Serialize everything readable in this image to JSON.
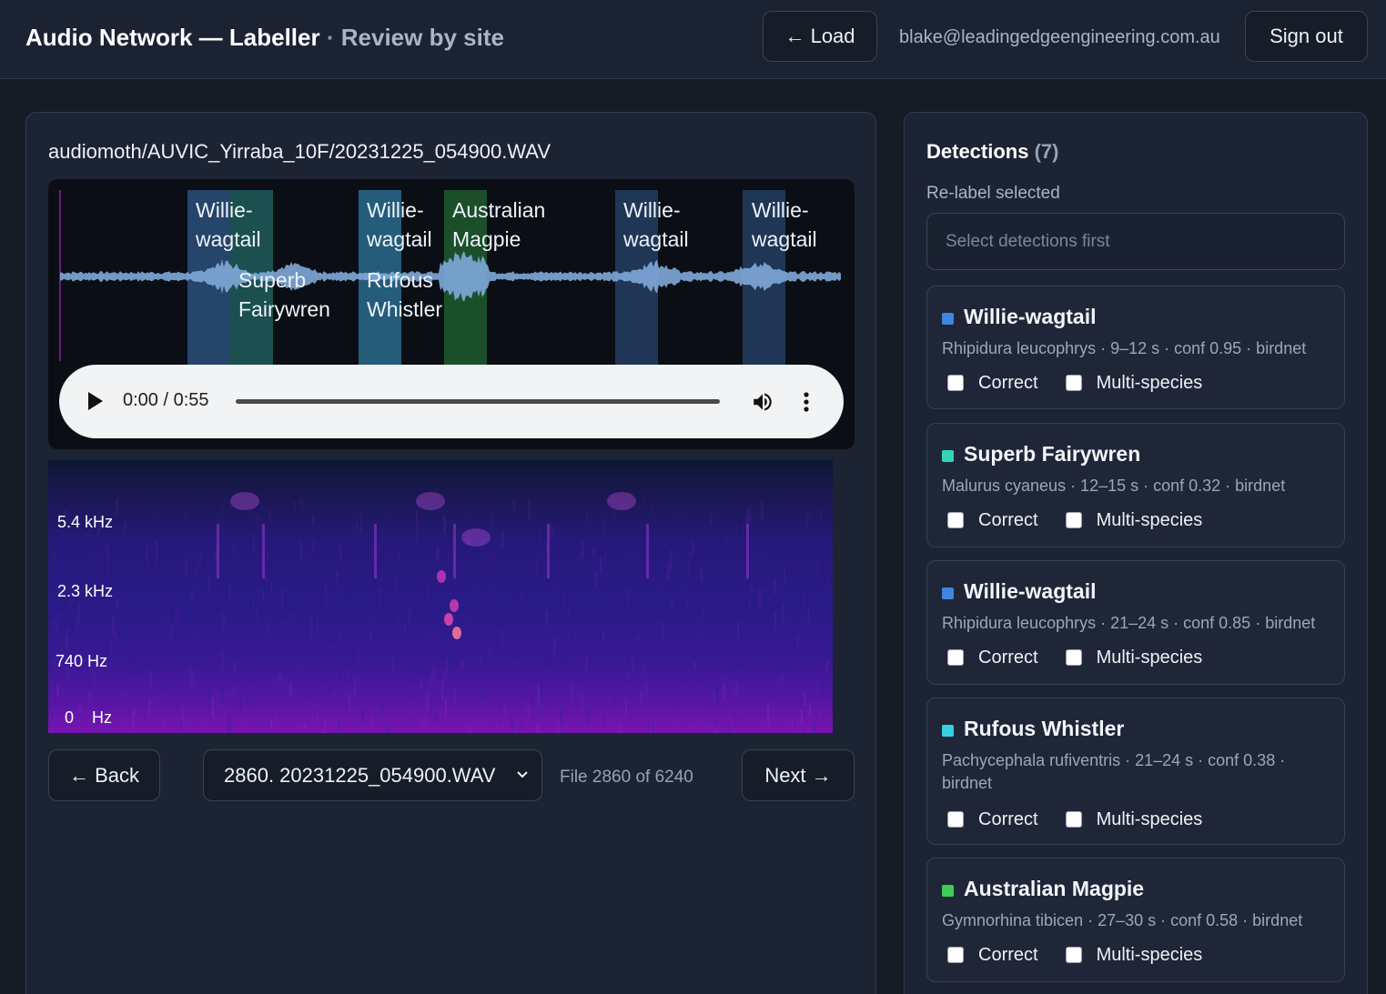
{
  "header": {
    "title": "Audio Network — Labeller",
    "separator": "·",
    "subtitle": "Review by site",
    "load_label": "← Load",
    "user_email": "blake@leadingedgeengineering.com.au",
    "signout_label": "Sign out"
  },
  "file": {
    "path": "audiomoth/AUVIC_Yirraba_10F/20231225_054900.WAV"
  },
  "waveform": {
    "regions": [
      {
        "label": "Willie-\nwagtail",
        "color": "#2c4f7a"
      },
      {
        "label": "Superb\nFairywren",
        "color": "#1f5a5a"
      },
      {
        "label": "Willie-\nwagtail",
        "color": "#2a6a8c"
      },
      {
        "label": "Australian\nMagpie",
        "color": "#1e5a2e"
      },
      {
        "label": "Rufous\nWhistler",
        "color": "#2a6a8c"
      },
      {
        "label": "Willie-\nwagtail",
        "color": "#233d63"
      },
      {
        "label": "Willie-\nwagtail",
        "color": "#233d63"
      }
    ]
  },
  "player": {
    "time": "0:00 / 0:55"
  },
  "spectrogram": {
    "freq_labels": [
      "5.4  kHz",
      "2.3  kHz",
      "740  Hz",
      "0    Hz"
    ]
  },
  "nav": {
    "back_label": "← Back",
    "selected_file": "2860. 20231225_054900.WAV",
    "file_count": "File 2860 of 6240",
    "next_label": "Next →"
  },
  "detections": {
    "title": "Detections",
    "count": "(7)",
    "relabel_label": "Re-label selected",
    "relabel_placeholder": "Select detections first",
    "correct_label": "Correct",
    "multi_label": "Multi-species",
    "items": [
      {
        "name": "Willie-wagtail",
        "meta": "Rhipidura leucophrys · 9–12 s · conf 0.95 · birdnet",
        "color": "#3f86e0"
      },
      {
        "name": "Superb Fairywren",
        "meta": "Malurus cyaneus · 12–15 s · conf 0.32 · birdnet",
        "color": "#34d3b7"
      },
      {
        "name": "Willie-wagtail",
        "meta": "Rhipidura leucophrys · 21–24 s · conf 0.85 · birdnet",
        "color": "#3f86e0"
      },
      {
        "name": "Rufous Whistler",
        "meta": "Pachycephala rufiventris · 21–24 s · conf 0.38 · birdnet",
        "color": "#38cfe0"
      },
      {
        "name": "Australian Magpie",
        "meta": "Gymnorhina tibicen · 27–30 s · conf 0.58 · birdnet",
        "color": "#3ccf57"
      }
    ]
  }
}
